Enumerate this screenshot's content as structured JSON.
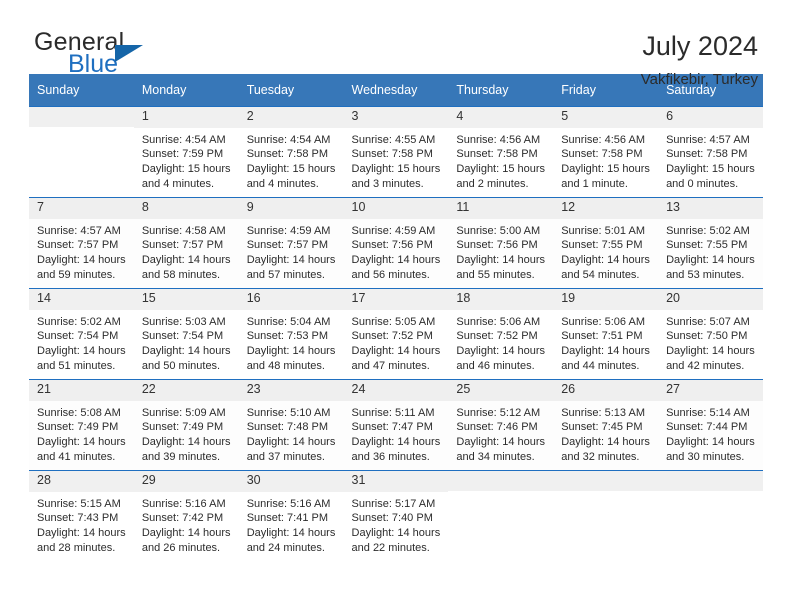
{
  "logo": {
    "line1": "General",
    "line2": "Blue",
    "accent_color": "#1f6fc0"
  },
  "header": {
    "title": "July 2024",
    "subtitle": "Vakfikebir, Turkey",
    "header_bg": "#3777b8",
    "grid_line": "#1f6fc0",
    "daynum_bg": "#f0f0f0"
  },
  "columns": [
    "Sunday",
    "Monday",
    "Tuesday",
    "Wednesday",
    "Thursday",
    "Friday",
    "Saturday"
  ],
  "labels": {
    "sunrise": "Sunrise:",
    "sunset": "Sunset:",
    "daylight": "Daylight:"
  },
  "weeks": [
    [
      {
        "day": "",
        "sunrise": "",
        "sunset": "",
        "daylight_line1": "",
        "daylight_line2": ""
      },
      {
        "day": "1",
        "sunrise": "Sunrise: 4:54 AM",
        "sunset": "Sunset: 7:59 PM",
        "daylight_line1": "Daylight: 15 hours",
        "daylight_line2": "and 4 minutes."
      },
      {
        "day": "2",
        "sunrise": "Sunrise: 4:54 AM",
        "sunset": "Sunset: 7:58 PM",
        "daylight_line1": "Daylight: 15 hours",
        "daylight_line2": "and 4 minutes."
      },
      {
        "day": "3",
        "sunrise": "Sunrise: 4:55 AM",
        "sunset": "Sunset: 7:58 PM",
        "daylight_line1": "Daylight: 15 hours",
        "daylight_line2": "and 3 minutes."
      },
      {
        "day": "4",
        "sunrise": "Sunrise: 4:56 AM",
        "sunset": "Sunset: 7:58 PM",
        "daylight_line1": "Daylight: 15 hours",
        "daylight_line2": "and 2 minutes."
      },
      {
        "day": "5",
        "sunrise": "Sunrise: 4:56 AM",
        "sunset": "Sunset: 7:58 PM",
        "daylight_line1": "Daylight: 15 hours",
        "daylight_line2": "and 1 minute."
      },
      {
        "day": "6",
        "sunrise": "Sunrise: 4:57 AM",
        "sunset": "Sunset: 7:58 PM",
        "daylight_line1": "Daylight: 15 hours",
        "daylight_line2": "and 0 minutes."
      }
    ],
    [
      {
        "day": "7",
        "sunrise": "Sunrise: 4:57 AM",
        "sunset": "Sunset: 7:57 PM",
        "daylight_line1": "Daylight: 14 hours",
        "daylight_line2": "and 59 minutes."
      },
      {
        "day": "8",
        "sunrise": "Sunrise: 4:58 AM",
        "sunset": "Sunset: 7:57 PM",
        "daylight_line1": "Daylight: 14 hours",
        "daylight_line2": "and 58 minutes."
      },
      {
        "day": "9",
        "sunrise": "Sunrise: 4:59 AM",
        "sunset": "Sunset: 7:57 PM",
        "daylight_line1": "Daylight: 14 hours",
        "daylight_line2": "and 57 minutes."
      },
      {
        "day": "10",
        "sunrise": "Sunrise: 4:59 AM",
        "sunset": "Sunset: 7:56 PM",
        "daylight_line1": "Daylight: 14 hours",
        "daylight_line2": "and 56 minutes."
      },
      {
        "day": "11",
        "sunrise": "Sunrise: 5:00 AM",
        "sunset": "Sunset: 7:56 PM",
        "daylight_line1": "Daylight: 14 hours",
        "daylight_line2": "and 55 minutes."
      },
      {
        "day": "12",
        "sunrise": "Sunrise: 5:01 AM",
        "sunset": "Sunset: 7:55 PM",
        "daylight_line1": "Daylight: 14 hours",
        "daylight_line2": "and 54 minutes."
      },
      {
        "day": "13",
        "sunrise": "Sunrise: 5:02 AM",
        "sunset": "Sunset: 7:55 PM",
        "daylight_line1": "Daylight: 14 hours",
        "daylight_line2": "and 53 minutes."
      }
    ],
    [
      {
        "day": "14",
        "sunrise": "Sunrise: 5:02 AM",
        "sunset": "Sunset: 7:54 PM",
        "daylight_line1": "Daylight: 14 hours",
        "daylight_line2": "and 51 minutes."
      },
      {
        "day": "15",
        "sunrise": "Sunrise: 5:03 AM",
        "sunset": "Sunset: 7:54 PM",
        "daylight_line1": "Daylight: 14 hours",
        "daylight_line2": "and 50 minutes."
      },
      {
        "day": "16",
        "sunrise": "Sunrise: 5:04 AM",
        "sunset": "Sunset: 7:53 PM",
        "daylight_line1": "Daylight: 14 hours",
        "daylight_line2": "and 48 minutes."
      },
      {
        "day": "17",
        "sunrise": "Sunrise: 5:05 AM",
        "sunset": "Sunset: 7:52 PM",
        "daylight_line1": "Daylight: 14 hours",
        "daylight_line2": "and 47 minutes."
      },
      {
        "day": "18",
        "sunrise": "Sunrise: 5:06 AM",
        "sunset": "Sunset: 7:52 PM",
        "daylight_line1": "Daylight: 14 hours",
        "daylight_line2": "and 46 minutes."
      },
      {
        "day": "19",
        "sunrise": "Sunrise: 5:06 AM",
        "sunset": "Sunset: 7:51 PM",
        "daylight_line1": "Daylight: 14 hours",
        "daylight_line2": "and 44 minutes."
      },
      {
        "day": "20",
        "sunrise": "Sunrise: 5:07 AM",
        "sunset": "Sunset: 7:50 PM",
        "daylight_line1": "Daylight: 14 hours",
        "daylight_line2": "and 42 minutes."
      }
    ],
    [
      {
        "day": "21",
        "sunrise": "Sunrise: 5:08 AM",
        "sunset": "Sunset: 7:49 PM",
        "daylight_line1": "Daylight: 14 hours",
        "daylight_line2": "and 41 minutes."
      },
      {
        "day": "22",
        "sunrise": "Sunrise: 5:09 AM",
        "sunset": "Sunset: 7:49 PM",
        "daylight_line1": "Daylight: 14 hours",
        "daylight_line2": "and 39 minutes."
      },
      {
        "day": "23",
        "sunrise": "Sunrise: 5:10 AM",
        "sunset": "Sunset: 7:48 PM",
        "daylight_line1": "Daylight: 14 hours",
        "daylight_line2": "and 37 minutes."
      },
      {
        "day": "24",
        "sunrise": "Sunrise: 5:11 AM",
        "sunset": "Sunset: 7:47 PM",
        "daylight_line1": "Daylight: 14 hours",
        "daylight_line2": "and 36 minutes."
      },
      {
        "day": "25",
        "sunrise": "Sunrise: 5:12 AM",
        "sunset": "Sunset: 7:46 PM",
        "daylight_line1": "Daylight: 14 hours",
        "daylight_line2": "and 34 minutes."
      },
      {
        "day": "26",
        "sunrise": "Sunrise: 5:13 AM",
        "sunset": "Sunset: 7:45 PM",
        "daylight_line1": "Daylight: 14 hours",
        "daylight_line2": "and 32 minutes."
      },
      {
        "day": "27",
        "sunrise": "Sunrise: 5:14 AM",
        "sunset": "Sunset: 7:44 PM",
        "daylight_line1": "Daylight: 14 hours",
        "daylight_line2": "and 30 minutes."
      }
    ],
    [
      {
        "day": "28",
        "sunrise": "Sunrise: 5:15 AM",
        "sunset": "Sunset: 7:43 PM",
        "daylight_line1": "Daylight: 14 hours",
        "daylight_line2": "and 28 minutes."
      },
      {
        "day": "29",
        "sunrise": "Sunrise: 5:16 AM",
        "sunset": "Sunset: 7:42 PM",
        "daylight_line1": "Daylight: 14 hours",
        "daylight_line2": "and 26 minutes."
      },
      {
        "day": "30",
        "sunrise": "Sunrise: 5:16 AM",
        "sunset": "Sunset: 7:41 PM",
        "daylight_line1": "Daylight: 14 hours",
        "daylight_line2": "and 24 minutes."
      },
      {
        "day": "31",
        "sunrise": "Sunrise: 5:17 AM",
        "sunset": "Sunset: 7:40 PM",
        "daylight_line1": "Daylight: 14 hours",
        "daylight_line2": "and 22 minutes."
      },
      {
        "day": "",
        "sunrise": "",
        "sunset": "",
        "daylight_line1": "",
        "daylight_line2": ""
      },
      {
        "day": "",
        "sunrise": "",
        "sunset": "",
        "daylight_line1": "",
        "daylight_line2": ""
      },
      {
        "day": "",
        "sunrise": "",
        "sunset": "",
        "daylight_line1": "",
        "daylight_line2": ""
      }
    ]
  ]
}
